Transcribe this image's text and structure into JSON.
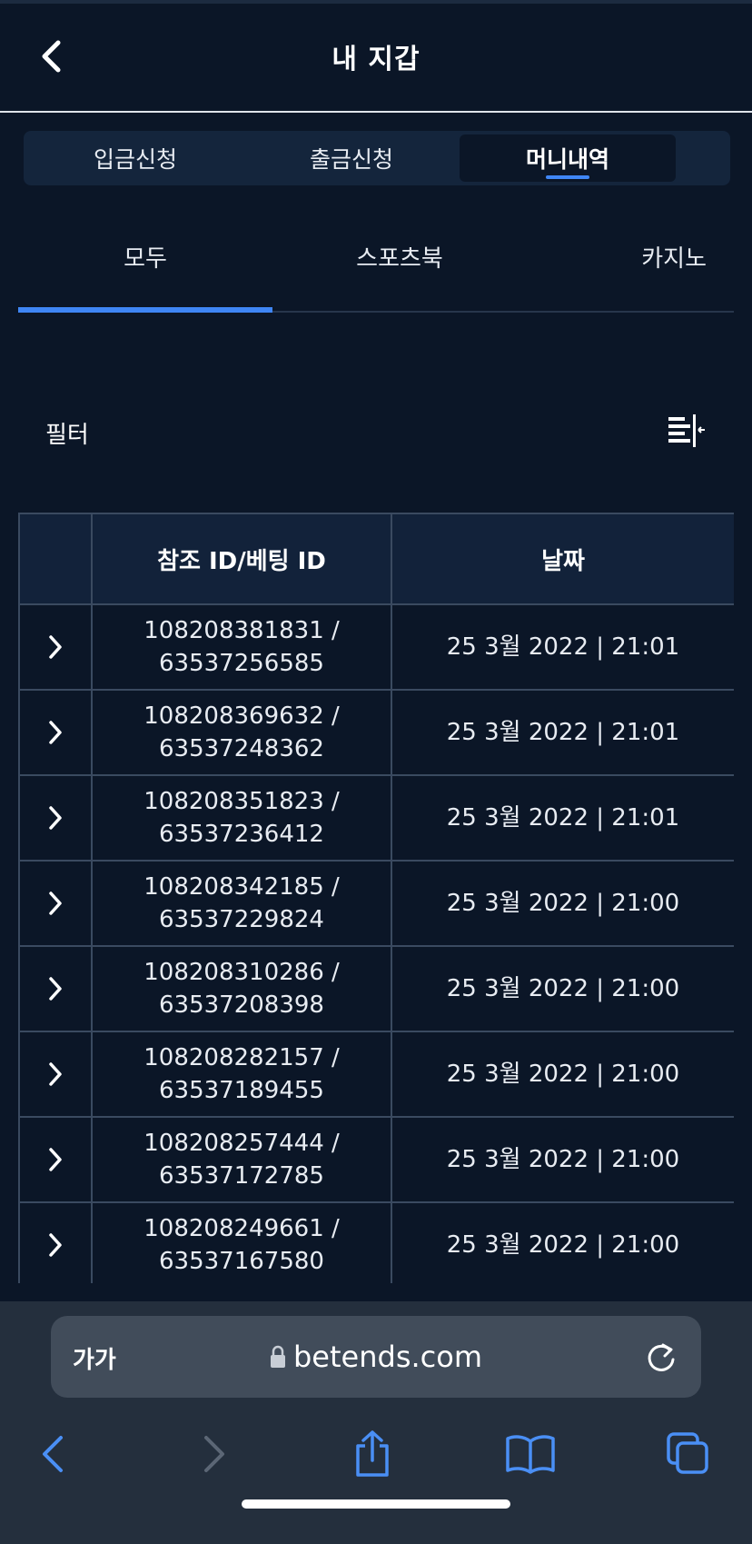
{
  "header": {
    "title": "내 지갑",
    "back_icon": "chevron-left-icon"
  },
  "wallet_tabs": [
    {
      "label": "입금신청",
      "active": false
    },
    {
      "label": "출금신청",
      "active": false
    },
    {
      "label": "머니내역",
      "active": true
    }
  ],
  "sub_tabs": [
    {
      "label": "모두",
      "active": true
    },
    {
      "label": "스포츠북",
      "active": false
    },
    {
      "label": "카지노",
      "active": false
    }
  ],
  "filter": {
    "label": "필터",
    "icon": "filter-collapse-icon"
  },
  "table": {
    "columns": [
      "",
      "참조 ID/베팅 ID",
      "날짜"
    ],
    "rows": [
      {
        "ref_id": "108208381831 /",
        "bet_id": "63537256585",
        "date": "25 3월 2022 | 21:01"
      },
      {
        "ref_id": "108208369632 /",
        "bet_id": "63537248362",
        "date": "25 3월 2022 | 21:01"
      },
      {
        "ref_id": "108208351823 /",
        "bet_id": "63537236412",
        "date": "25 3월 2022 | 21:01"
      },
      {
        "ref_id": "108208342185 /",
        "bet_id": "63537229824",
        "date": "25 3월 2022 | 21:00"
      },
      {
        "ref_id": "108208310286 /",
        "bet_id": "63537208398",
        "date": "25 3월 2022 | 21:00"
      },
      {
        "ref_id": "108208282157 /",
        "bet_id": "63537189455",
        "date": "25 3월 2022 | 21:00"
      },
      {
        "ref_id": "108208257444 /",
        "bet_id": "63537172785",
        "date": "25 3월 2022 | 21:00"
      },
      {
        "ref_id": "108208249661 /",
        "bet_id": "63537167580",
        "date": "25 3월 2022 | 21:00"
      }
    ]
  },
  "browser": {
    "text_size_label": "가가",
    "url": "betends.com",
    "icons": [
      "lock-icon",
      "reload-icon",
      "back-icon",
      "forward-icon",
      "share-icon",
      "bookmarks-icon",
      "tabs-icon"
    ]
  },
  "colors": {
    "background": "#0b1627",
    "accent": "#3f86f5",
    "table_header": "#12223a",
    "browser_bar": "#242f3d"
  }
}
